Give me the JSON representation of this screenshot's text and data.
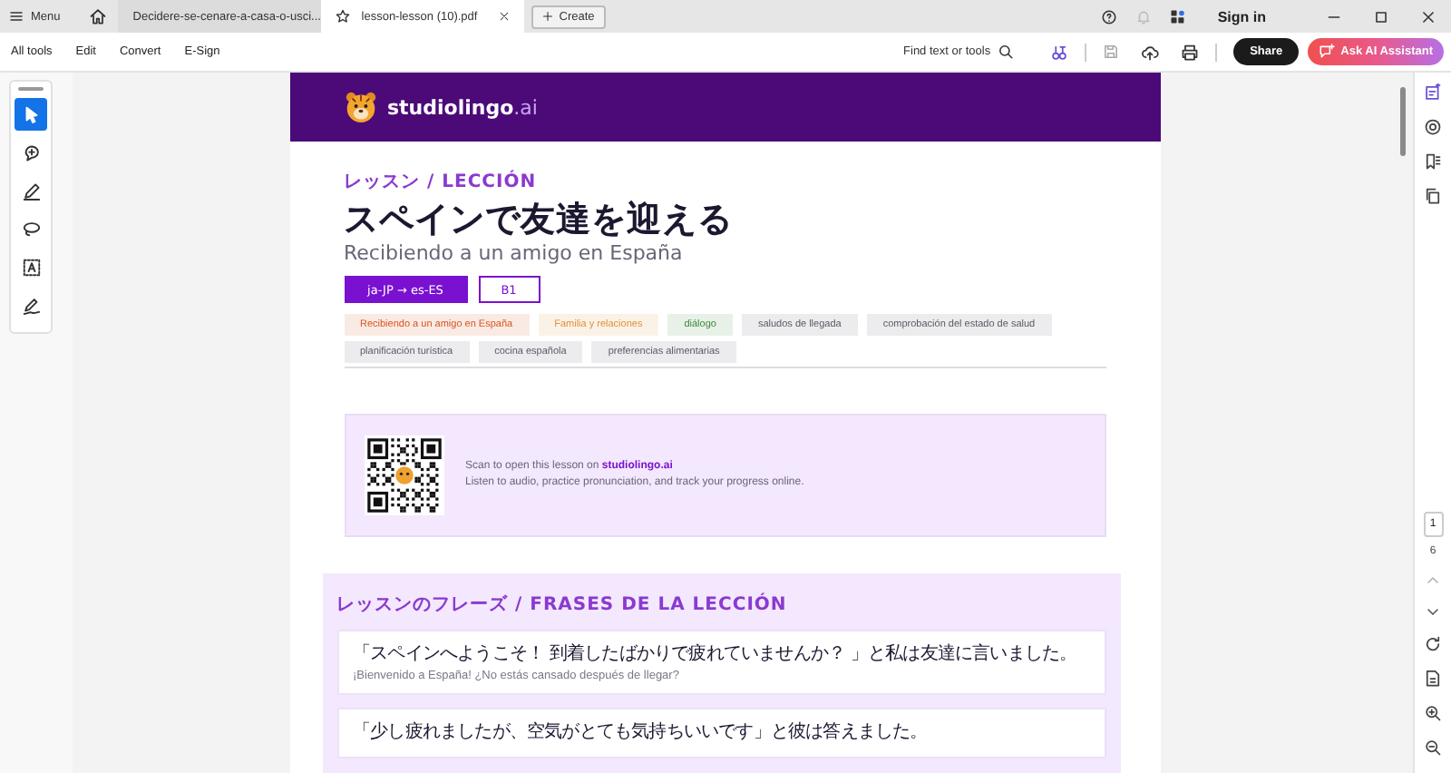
{
  "titlebar": {
    "menu_label": "Menu",
    "tabs": [
      {
        "label": "Decidere-se-cenare-a-casa-o-usci...",
        "selected": false
      },
      {
        "label": "lesson-lesson (10).pdf",
        "selected": true
      }
    ],
    "create_label": "Create",
    "sign_in": "Sign in"
  },
  "toolbar": {
    "menus": [
      "All tools",
      "Edit",
      "Convert",
      "E-Sign"
    ],
    "search_placeholder": "Find text or tools",
    "share": "Share",
    "ai_assistant": "Ask AI Assistant"
  },
  "tools": [
    {
      "kind": "select",
      "selected": true
    },
    {
      "kind": "comment",
      "selected": false
    },
    {
      "kind": "draw",
      "selected": false
    },
    {
      "kind": "lasso",
      "selected": false
    },
    {
      "kind": "text",
      "selected": false
    },
    {
      "kind": "sign",
      "selected": false
    }
  ],
  "page_nav": {
    "current": "1",
    "total": "6"
  },
  "lesson": {
    "brand": {
      "name": "studiolingo",
      "suffix": ".ai"
    },
    "eyebrow": "レッスン / LECCIÓN",
    "title": "スペインで友達を迎える",
    "subtitle": "Recibiendo a un amigo en España",
    "language_pair": "ja-JP → es-ES",
    "level": "B1",
    "tags": [
      {
        "label": "Recibiendo a un amigo en España",
        "color": "#d9541e"
      },
      {
        "label": "Familia y relaciones",
        "color": "#e0913a"
      },
      {
        "label": "diálogo",
        "color": "#3d8a3a"
      },
      {
        "label": "saludos de llegada",
        "color": "#5e5a66"
      },
      {
        "label": "comprobación del estado de salud",
        "color": "#5e5a66"
      },
      {
        "label": "planificación turística",
        "color": "#5e5a66"
      },
      {
        "label": "cocina española",
        "color": "#5e5a66"
      },
      {
        "label": "preferencias alimentarias",
        "color": "#5e5a66"
      }
    ],
    "qr_card": {
      "text": "Scan to open this lesson on",
      "link": "studiolingo.ai",
      "note": "Listen to audio, practice pronunciation, and track your progress online."
    },
    "phrases": {
      "heading": "レッスンのフレーズ / FRASES DE LA LECCIÓN",
      "items": [
        {
          "ja": "「スペインへようこそ！ 到着したばかりで疲れていませんか？ 」と私は友達に言いました。",
          "es": "¡Bienvenido a España! ¿No estás cansado después de llegar?"
        },
        {
          "ja": "「少し疲れましたが、空気がとても気持ちいいです」と彼は答えました。"
        }
      ]
    }
  }
}
